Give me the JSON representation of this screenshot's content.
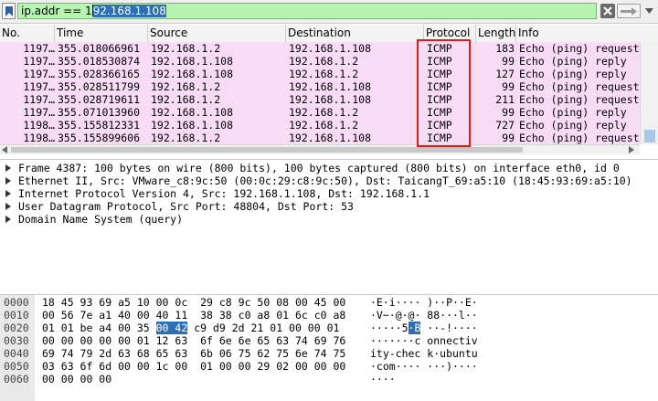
{
  "filter": {
    "value_pre": "ip.addr == 1",
    "value_selected": "92.168.1.108"
  },
  "columns": [
    "No.",
    "Time",
    "Source",
    "Destination",
    "Protocol",
    "Length",
    "Info"
  ],
  "packets": [
    {
      "no": "1197…",
      "time": "355.018066961",
      "src": "192.168.1.2",
      "dst": "192.168.1.108",
      "proto": "ICMP",
      "len": "183",
      "info": "Echo (ping) request"
    },
    {
      "no": "1197…",
      "time": "355.018530874",
      "src": "192.168.1.108",
      "dst": "192.168.1.2",
      "proto": "ICMP",
      "len": "99",
      "info": "Echo (ping) reply"
    },
    {
      "no": "1197…",
      "time": "355.028366165",
      "src": "192.168.1.108",
      "dst": "192.168.1.2",
      "proto": "ICMP",
      "len": "127",
      "info": "Echo (ping) reply"
    },
    {
      "no": "1197…",
      "time": "355.028511799",
      "src": "192.168.1.2",
      "dst": "192.168.1.108",
      "proto": "ICMP",
      "len": "99",
      "info": "Echo (ping) request"
    },
    {
      "no": "1197…",
      "time": "355.028719611",
      "src": "192.168.1.2",
      "dst": "192.168.1.108",
      "proto": "ICMP",
      "len": "211",
      "info": "Echo (ping) request"
    },
    {
      "no": "1197…",
      "time": "355.071013960",
      "src": "192.168.1.108",
      "dst": "192.168.1.2",
      "proto": "ICMP",
      "len": "99",
      "info": "Echo (ping) reply"
    },
    {
      "no": "1198…",
      "time": "355.155812331",
      "src": "192.168.1.108",
      "dst": "192.168.1.2",
      "proto": "ICMP",
      "len": "727",
      "info": "Echo (ping) reply"
    },
    {
      "no": "1198…",
      "time": "355.155899606",
      "src": "192.168.1.2",
      "dst": "192.168.1.108",
      "proto": "ICMP",
      "len": "99",
      "info": "Echo (ping) request"
    }
  ],
  "details": [
    "Frame 4387: 100 bytes on wire (800 bits), 100 bytes captured (800 bits) on interface eth0, id 0",
    "Ethernet II, Src: VMware_c8:9c:50 (00:0c:29:c8:9c:50), Dst: TaicangT_69:a5:10 (18:45:93:69:a5:10)",
    "Internet Protocol Version 4, Src: 192.168.1.108, Dst: 192.168.1.1",
    "User Datagram Protocol, Src Port: 48804, Dst Port: 53",
    "Domain Name System (query)"
  ],
  "bytes": [
    {
      "offset": "0000",
      "hex_a": "18 45 93 69 a5 10 00 0c",
      "hex_b": "29 c8 9c 50 08 00 45 00",
      "ascii": "·E·i···· )··P··E·"
    },
    {
      "offset": "0010",
      "hex_a": "00 56 7e a1 40 00 40 11",
      "hex_b": "38 38 c0 a8 01 6c c0 a8",
      "ascii": "·V~·@·@· 88···l··"
    },
    {
      "offset": "0020",
      "hex_a1": "01 01 be a4 00 35 ",
      "hex_sel": "00 42",
      "hex_b": "c9 d9 2d 21 01 00 00 01",
      "ascii_a": "·····5",
      "ascii_sel": "·B",
      "ascii_b": " ··-!····"
    },
    {
      "offset": "0030",
      "hex_a": "00 00 00 00 00 01 12 63",
      "hex_b": "6f 6e 6e 65 63 74 69 76",
      "ascii": "·······c onnectiv"
    },
    {
      "offset": "0040",
      "hex_a": "69 74 79 2d 63 68 65 63",
      "hex_b": "6b 06 75 62 75 6e 74 75",
      "ascii": "ity-chec k·ubuntu"
    },
    {
      "offset": "0050",
      "hex_a": "03 63 6f 6d 00 00 1c 00",
      "hex_b": "01 00 00 29 02 00 00 00",
      "ascii": "·com···· ···)····"
    },
    {
      "offset": "0060",
      "hex_a": "00 00 00 00",
      "hex_b": "",
      "ascii": "····"
    }
  ],
  "colors": {
    "row_bg": "#f8dcf6",
    "filter_bg": "#b7f3b1",
    "highlight_box": "#e01b1b",
    "selection": "#2d6fb7"
  }
}
